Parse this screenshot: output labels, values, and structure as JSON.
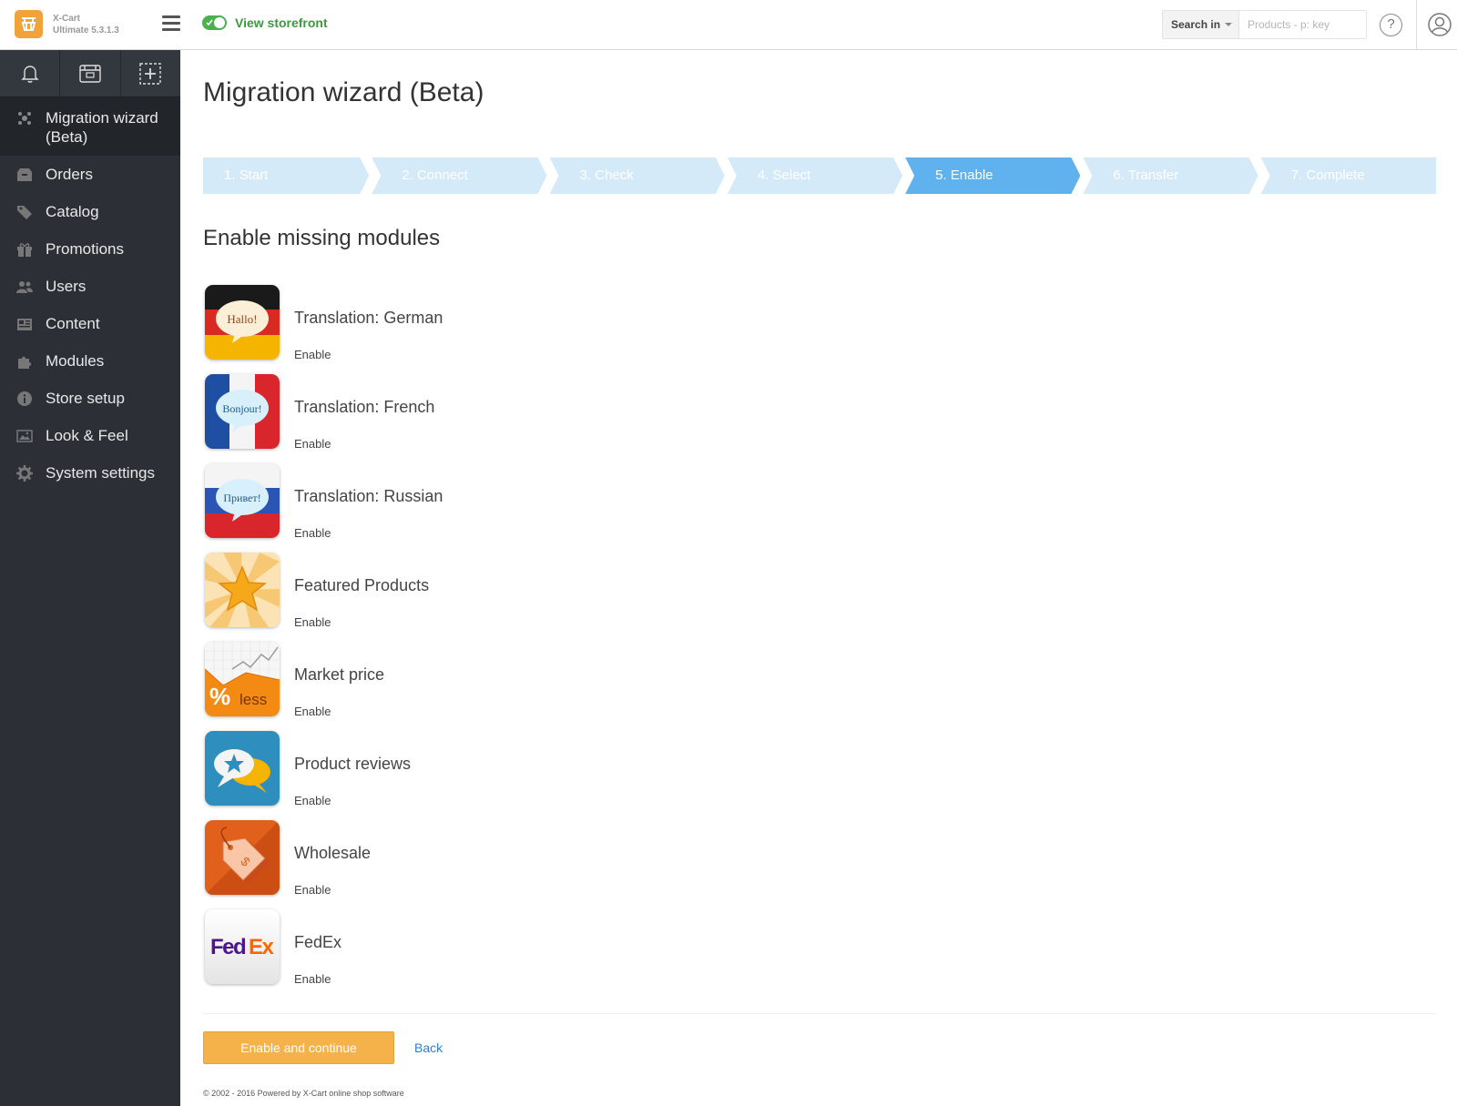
{
  "header": {
    "brand_name": "X-Cart",
    "brand_version": "Ultimate 5.3.1.3",
    "storefront_label": "View storefront",
    "search_in_label": "Search in",
    "search_placeholder": "Products - p: key",
    "help_label": "?"
  },
  "sidebar": {
    "quick_icons": [
      "bell-icon",
      "storefront-icon",
      "add-product-icon"
    ],
    "items": [
      {
        "label": "Migration wizard (Beta)",
        "icon": "wizard-icon",
        "active": true
      },
      {
        "label": "Orders",
        "icon": "orders-icon"
      },
      {
        "label": "Catalog",
        "icon": "catalog-icon"
      },
      {
        "label": "Promotions",
        "icon": "promotions-icon"
      },
      {
        "label": "Users",
        "icon": "users-icon"
      },
      {
        "label": "Content",
        "icon": "content-icon"
      },
      {
        "label": "Modules",
        "icon": "modules-icon"
      },
      {
        "label": "Store setup",
        "icon": "info-icon"
      },
      {
        "label": "Look & Feel",
        "icon": "image-icon"
      },
      {
        "label": "System settings",
        "icon": "gear-icon"
      }
    ]
  },
  "main": {
    "title": "Migration wizard (Beta)",
    "steps": [
      {
        "label": "1. Start"
      },
      {
        "label": "2. Connect"
      },
      {
        "label": "3. Check"
      },
      {
        "label": "4. Select"
      },
      {
        "label": "5. Enable",
        "active": true
      },
      {
        "label": "6. Transfer"
      },
      {
        "label": "7. Complete"
      }
    ],
    "section_title": "Enable missing modules",
    "modules": [
      {
        "name": "Translation: German",
        "action": "Enable",
        "icon_text": "Hallo!"
      },
      {
        "name": "Translation: French",
        "action": "Enable",
        "icon_text": "Bonjour!"
      },
      {
        "name": "Translation: Russian",
        "action": "Enable",
        "icon_text": "Привет!"
      },
      {
        "name": "Featured Products",
        "action": "Enable"
      },
      {
        "name": "Market price",
        "action": "Enable",
        "icon_text": "% less"
      },
      {
        "name": "Product reviews",
        "action": "Enable"
      },
      {
        "name": "Wholesale",
        "action": "Enable"
      },
      {
        "name": "FedEx",
        "action": "Enable",
        "icon_text": "FedEx"
      }
    ],
    "primary_button": "Enable and continue",
    "back_link": "Back",
    "footer": "© 2002 - 2016 Powered by X-Cart online shop software"
  },
  "colors": {
    "sidebar_bg": "#2c3036",
    "step_inactive": "#d5eaf9",
    "step_active": "#5fb2ee",
    "primary_button": "#f5b24a",
    "storefront_green": "#4caf50",
    "logo_orange": "#f0a33a",
    "link_blue": "#2b82c9"
  }
}
